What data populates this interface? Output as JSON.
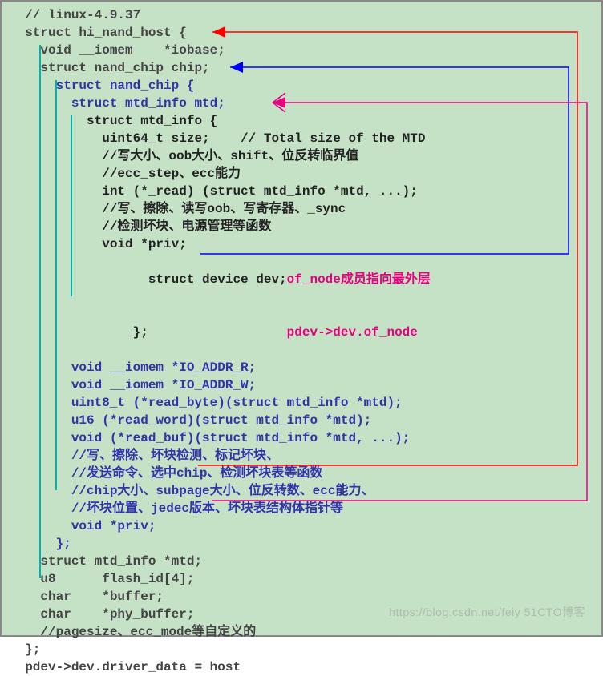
{
  "code": {
    "l1": "  // linux-4.9.37",
    "l2": "  struct hi_nand_host {",
    "l3": "    void __iomem    *iobase;",
    "l4": "    struct nand_chip chip;",
    "l5": "      struct nand_chip {",
    "l6": "        struct mtd_info mtd;",
    "l7": "          struct mtd_info {",
    "l8": "            uint64_t size;    // Total size of the MTD",
    "l9": "            //写大小、oob大小、shift、位反转临界值",
    "l10": "            //ecc_step、ecc能力",
    "l11": "            int (*_read) (struct mtd_info *mtd, ...);",
    "l12": "            //写、擦除、读写oob、写寄存器、_sync",
    "l13": "            //检测坏块、电源管理等函数",
    "l14": "            void *priv;",
    "l15": "            struct device dev;",
    "l16": "          };",
    "l17": "        void __iomem *IO_ADDR_R;",
    "l18": "        void __iomem *IO_ADDR_W;",
    "l19": "        uint8_t (*read_byte)(struct mtd_info *mtd);",
    "l20": "        u16 (*read_word)(struct mtd_info *mtd);",
    "l21": "        void (*read_buf)(struct mtd_info *mtd, ...);",
    "l22": "        //写、擦除、坏块检测、标记坏块、",
    "l23": "        //发送命令、选中chip、检测坏块表等函数",
    "l24": "        //chip大小、subpage大小、位反转数、ecc能力、",
    "l25": "        //坏块位置、jedec版本、坏块表结构体指针等",
    "l26": "        void *priv;",
    "l27": "      };",
    "l28": "    struct mtd_info *mtd;",
    "l29": "    u8      flash_id[4];",
    "l30": "    char    *buffer;",
    "l31": "    char    *phy_buffer;",
    "l32": "    //pagesize、ecc_mode等自定义的",
    "l33": "  };",
    "l34": "  pdev->dev.driver_data = host"
  },
  "annotation": {
    "a1": "of_node成员指向最外层",
    "a2": "pdev->dev.of_node"
  },
  "watermark": "https://blog.csdn.net/feiy   51CTO博客"
}
